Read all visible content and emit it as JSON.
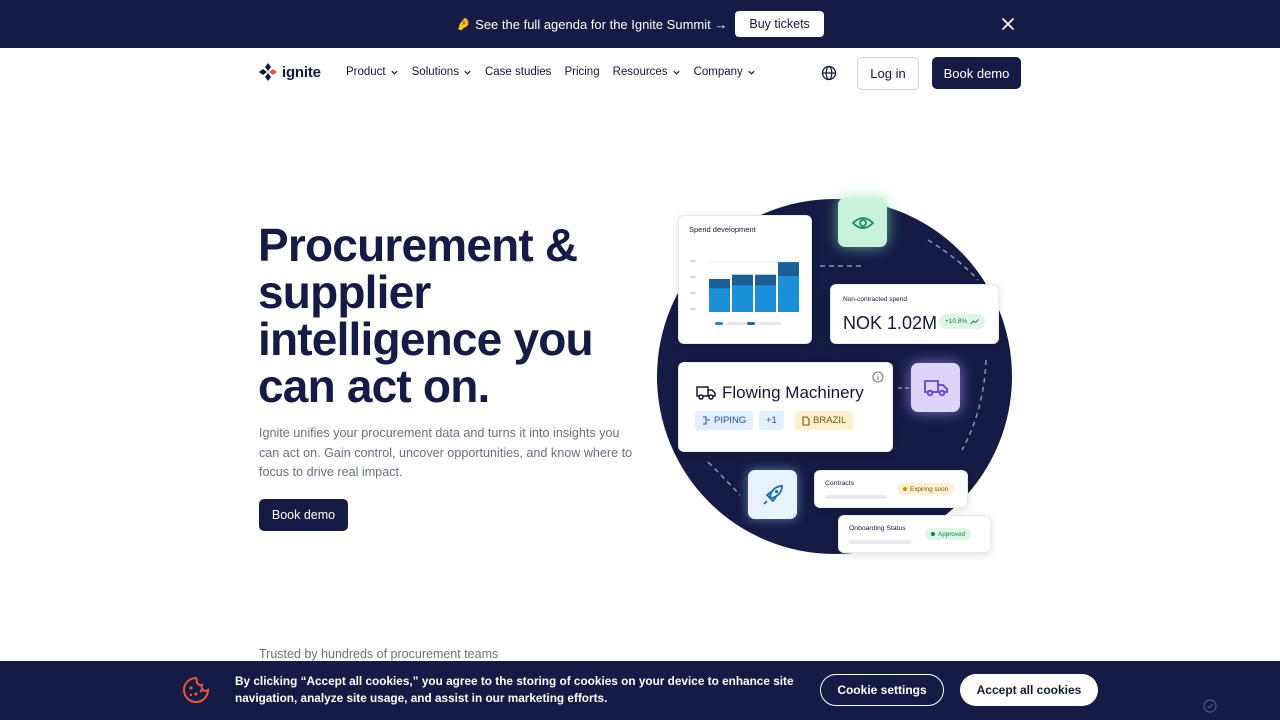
{
  "announcement": {
    "emoji": "🤌",
    "text": "See the full agenda for the Ignite Summit →",
    "cta": "Buy tickets"
  },
  "nav": {
    "brand": "ignite",
    "items": [
      {
        "label": "Product",
        "dropdown": true
      },
      {
        "label": "Solutions",
        "dropdown": true
      },
      {
        "label": "Case studies",
        "dropdown": false
      },
      {
        "label": "Pricing",
        "dropdown": false
      },
      {
        "label": "Resources",
        "dropdown": true
      },
      {
        "label": "Company",
        "dropdown": true
      }
    ],
    "login": "Log in",
    "book_demo": "Book demo"
  },
  "hero": {
    "title": "Procurement & supplier intelligence you can act on.",
    "subtitle": "Ignite unifies your procurement data and turns it into insights you can act on. Gain control, uncover opportunities, and know where to focus to drive real impact.",
    "cta": "Book demo"
  },
  "illustration": {
    "spend_card": {
      "title": "Spend development",
      "bars": [
        0.55,
        0.62,
        0.62,
        0.83
      ]
    },
    "noncontracted": {
      "title": "Non-contracted spend",
      "value": "NOK 1.02M",
      "badge": "+10.8%"
    },
    "supplier": {
      "name": "Flowing Machinery",
      "tags": [
        "PIPING",
        "+1",
        "BRAZIL"
      ]
    },
    "contracts": {
      "title": "Contracts",
      "status": "Expiring soon"
    },
    "onboarding": {
      "title": "Onboarding Status",
      "status": "Approved"
    }
  },
  "trusted": "Trusted by hundreds of procurement teams",
  "cookie": {
    "message": "By clicking “Accept all cookies,” you agree to the storing of cookies on your device to enhance site navigation, analyze site usage, and assist in our marketing efforts.",
    "settings": "Cookie settings",
    "accept": "Accept all cookies"
  },
  "colors": {
    "navy": "#161b45",
    "accent_blue": "#1b8fd8",
    "green_badge": "#dff5e7"
  }
}
